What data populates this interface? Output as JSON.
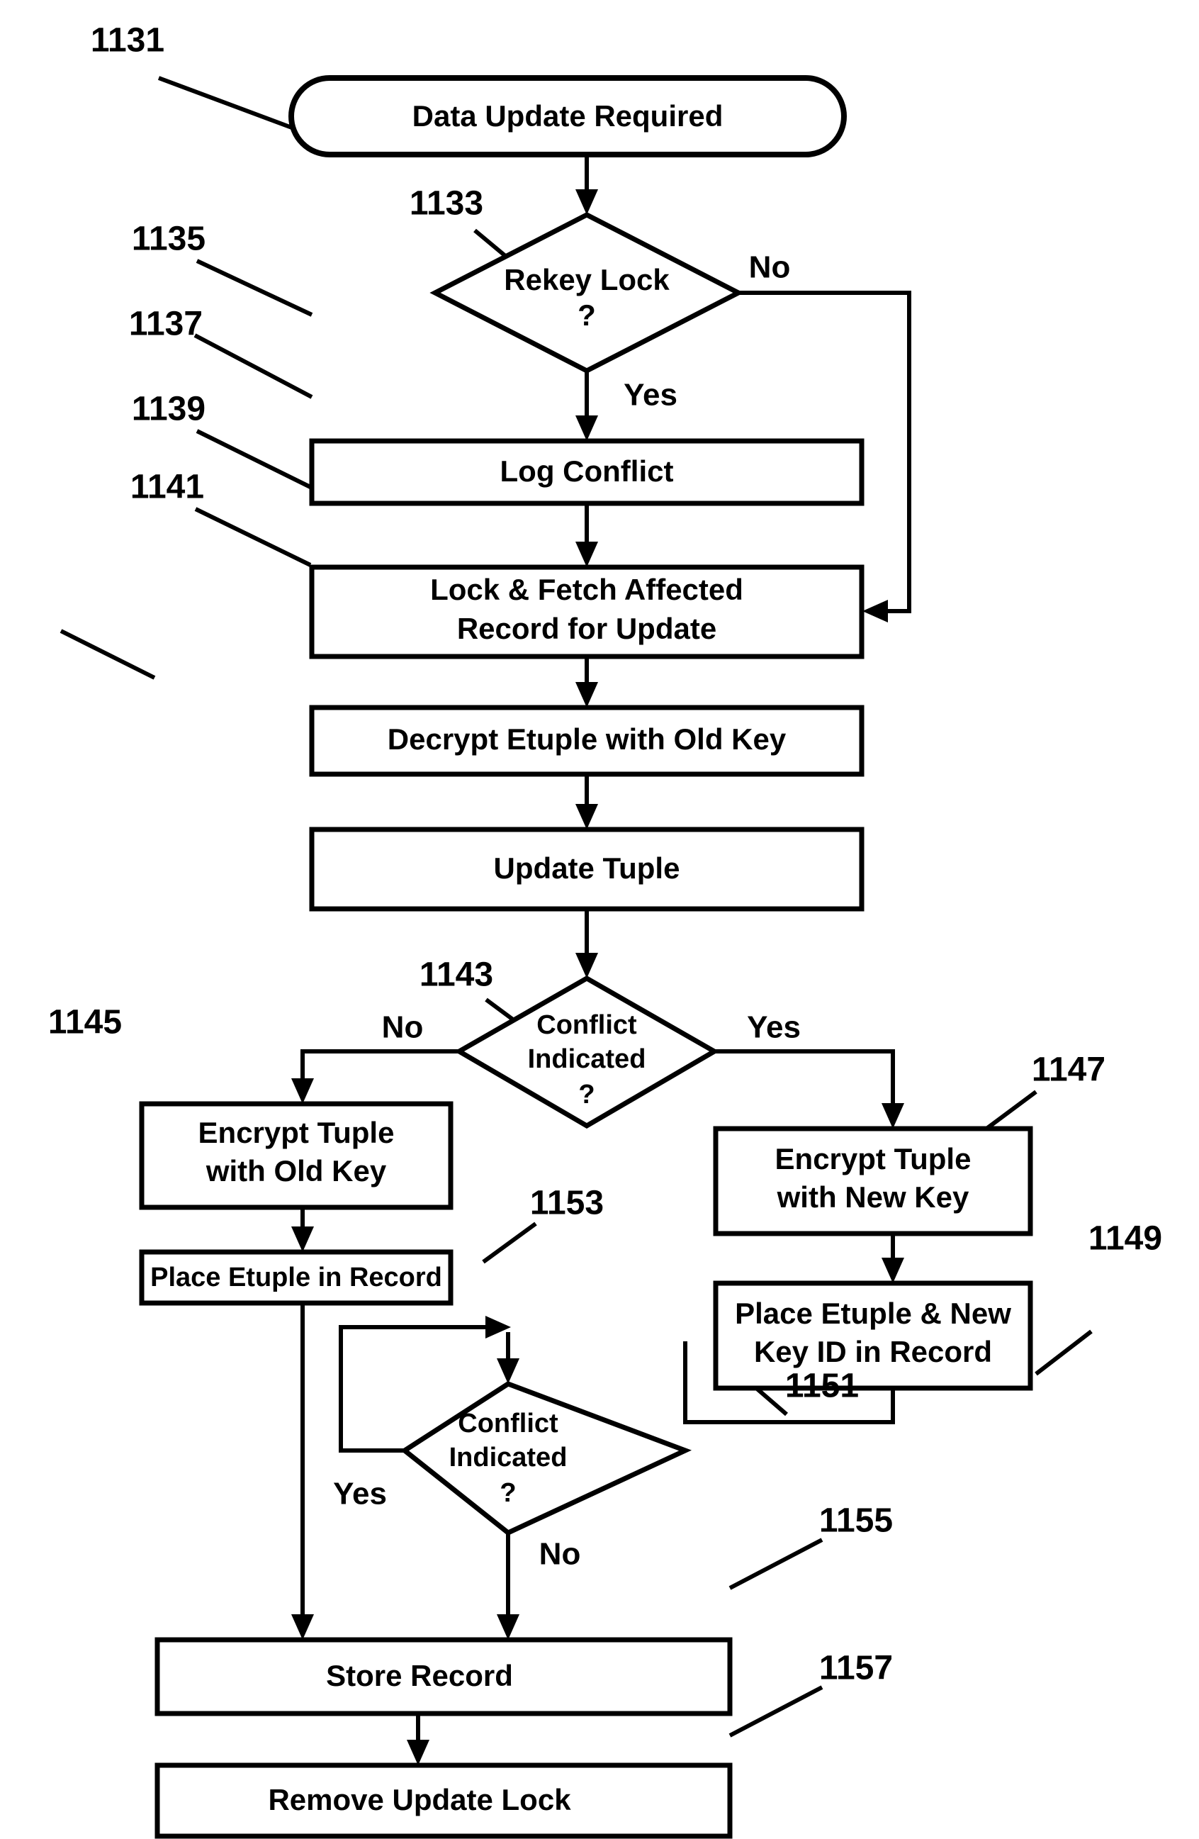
{
  "figure": {
    "type": "flowchart",
    "title": "Data Update Required flowchart",
    "line_color": "#000000",
    "background_color": "#ffffff"
  },
  "nodes": {
    "start": {
      "ref": "1131",
      "shape": "terminator",
      "label": "Data Update Required"
    },
    "rekey_lock": {
      "ref": "1133",
      "shape": "decision",
      "line1": "Rekey Lock",
      "line2": "?"
    },
    "log_conflict": {
      "ref": "1135",
      "shape": "process",
      "label": "Log Conflict"
    },
    "lock_fetch": {
      "ref": "1137",
      "shape": "process",
      "line1": "Lock & Fetch Affected",
      "line2": "Record for Update"
    },
    "decrypt_etuple": {
      "ref": "1139",
      "shape": "process",
      "label": "Decrypt Etuple with Old Key"
    },
    "update_tuple": {
      "ref": "1141",
      "shape": "process",
      "label": "Update Tuple"
    },
    "conflict_indicated_1": {
      "ref": "1143",
      "shape": "decision",
      "line1": "Conflict",
      "line2": "Indicated",
      "line3": "?"
    },
    "encrypt_old_key": {
      "ref": "1145",
      "shape": "process",
      "line1": "Encrypt Tuple",
      "line2": "with Old Key"
    },
    "encrypt_new_key": {
      "ref": "1147",
      "shape": "process",
      "line1": "Encrypt Tuple",
      "line2": "with New Key"
    },
    "place_etuple_newkey": {
      "ref": "1149",
      "shape": "process",
      "line1": "Place Etuple & New",
      "line2": "Key ID in Record"
    },
    "conflict_indicated_2": {
      "ref": "1151",
      "shape": "decision",
      "line1": "Conflict",
      "line2": "Indicated",
      "line3": "?"
    },
    "place_etuple": {
      "ref": "1153",
      "shape": "process",
      "label": "Place Etuple in Record"
    },
    "store_record": {
      "ref": "1155",
      "shape": "process",
      "label": "Store Record"
    },
    "remove_update_lock": {
      "ref": "1157",
      "shape": "process",
      "label": "Remove Update Lock"
    }
  },
  "edge_labels": {
    "rekey_no": "No",
    "rekey_yes": "Yes",
    "conflict1_no": "No",
    "conflict1_yes": "Yes",
    "conflict2_yes": "Yes",
    "conflict2_no": "No"
  }
}
